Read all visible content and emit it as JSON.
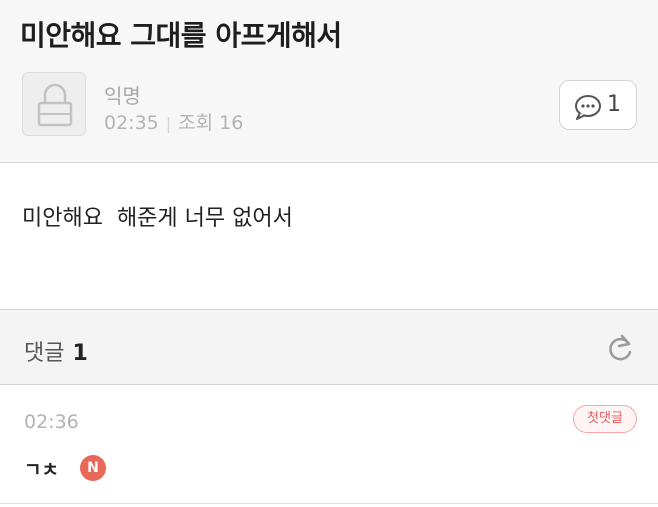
{
  "post": {
    "title": "미안해요 그대를 아프게해서",
    "author": "익명",
    "time": "02:35",
    "views_label": "조회 16",
    "comment_count": "1",
    "body": "미안해요  해준게 너무 없어서"
  },
  "comments": {
    "title": "댓글",
    "count": "1",
    "items": [
      {
        "time": "02:36",
        "badge": "첫댓글",
        "text": "ㄱㅊ",
        "new_marker": "N"
      }
    ]
  },
  "icons": {
    "avatar": "lock-icon",
    "comment_count": "speech-bubble-icon",
    "refresh": "refresh-icon"
  },
  "colors": {
    "badge_red": "#e06060",
    "new_badge": "#e8695a",
    "muted_text": "#b4b4b4"
  }
}
